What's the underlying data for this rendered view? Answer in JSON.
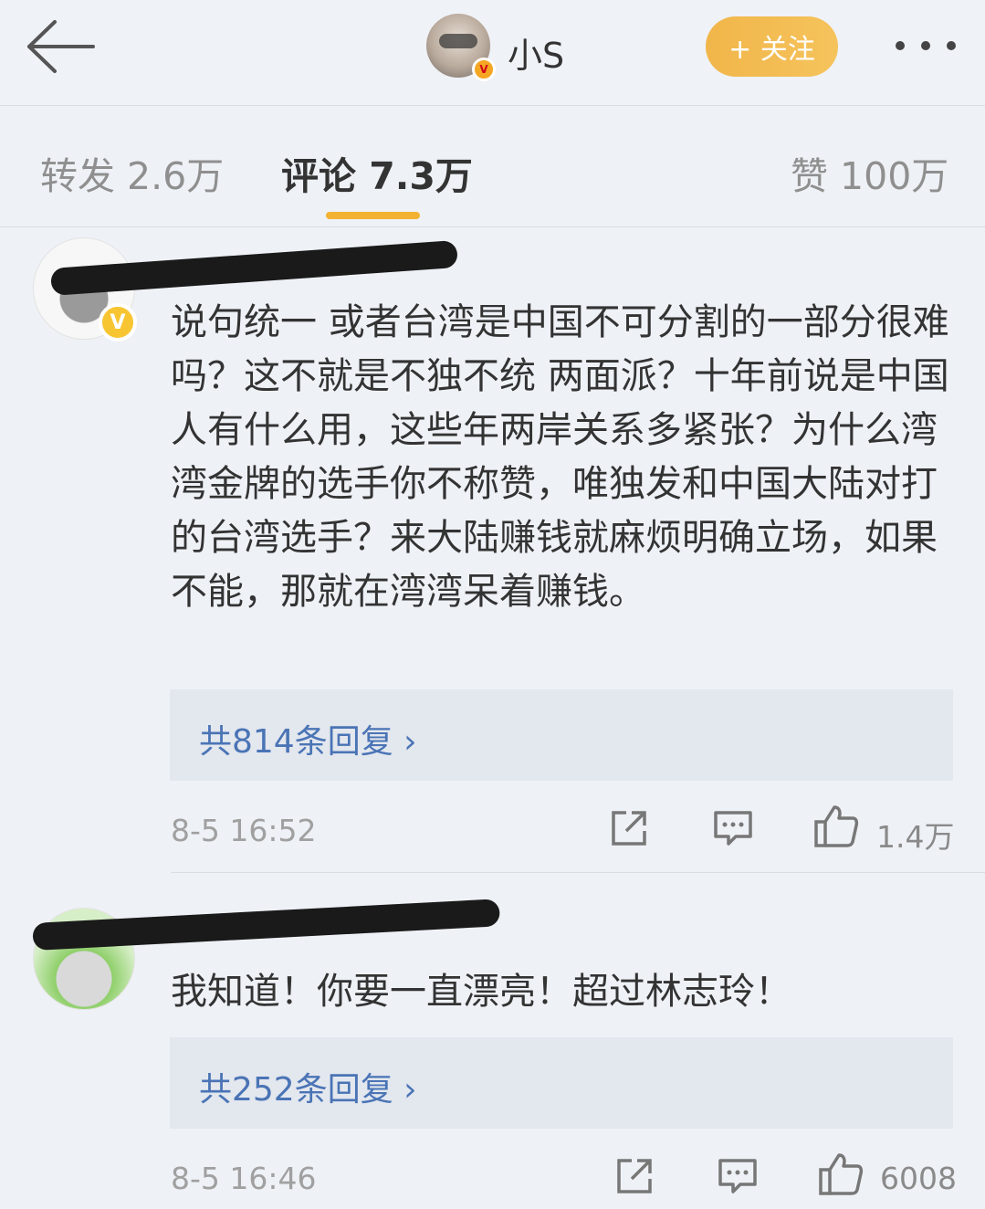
{
  "header": {
    "username": "小S",
    "verified_badge": "V",
    "follow_label": "+ 关注",
    "more_label": "•••",
    "icons": {
      "back": "arrow-left-icon",
      "more": "more-dots-icon"
    }
  },
  "tabs": {
    "repost": "转发 2.6万",
    "comment": "评论 7.3万",
    "like": "赞 100万"
  },
  "comments": [
    {
      "verified_badge": "V",
      "text": "说句统一 或者台湾是中国不可分割的一部分很难吗？这不就是不独不统 两面派？十年前说是中国人有什么用，这些年两岸关系多紧张？为什么湾湾金牌的选手你不称赞，唯独发和中国大陆对打的台湾选手？来大陆赚钱就麻烦明确立场，如果不能，那就在湾湾呆着赚钱。",
      "replies_label": "共814条回复",
      "time": "8-5 16:52",
      "likes": "1.4万"
    },
    {
      "text": "我知道！你要一直漂亮！超过林志玲！",
      "replies_label": "共252条回复",
      "time": "8-5 16:46",
      "likes": "6008"
    }
  ],
  "colors": {
    "accent": "#f4b232",
    "link": "#4a74b5",
    "background": "#eef1f6"
  }
}
